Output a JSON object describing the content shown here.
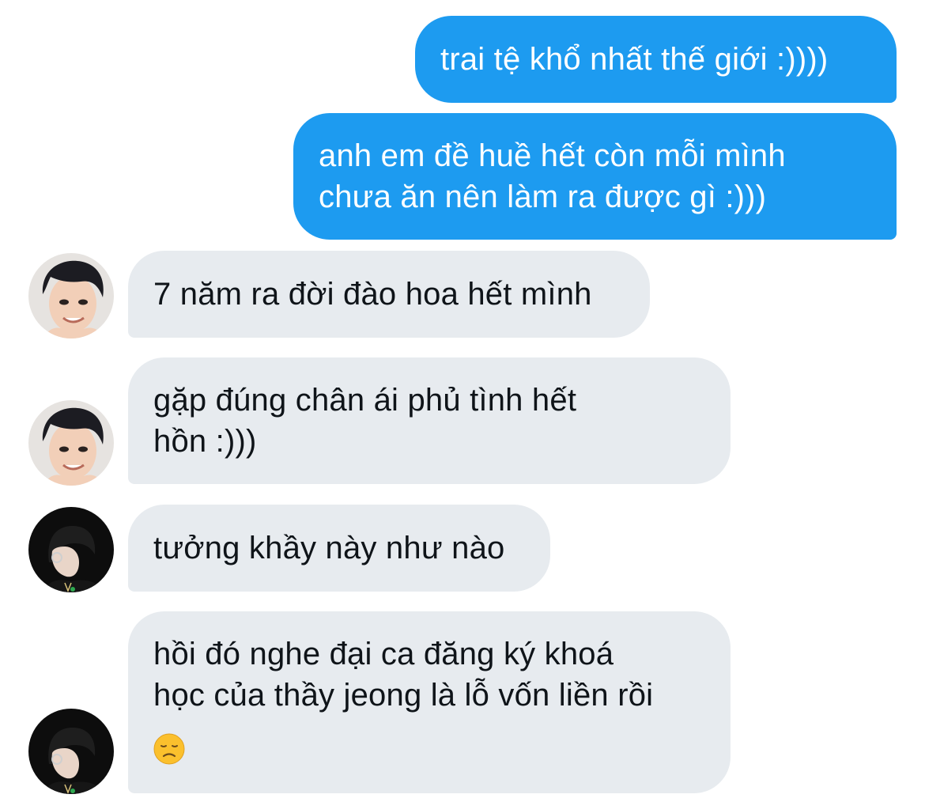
{
  "messages": [
    {
      "direction": "sent",
      "lines": [
        "trai tệ khổ nhất thế giới :))))"
      ]
    },
    {
      "direction": "sent",
      "lines": [
        "anh em đề huề hết còn mỗi mình",
        "chưa ăn nên làm ra được gì :)))"
      ]
    },
    {
      "direction": "received",
      "sender": "contact-1",
      "lines": [
        "7 năm ra đời đào hoa hết mình"
      ]
    },
    {
      "direction": "received",
      "sender": "contact-1",
      "lines": [
        "gặp đúng chân ái phủ tình hết",
        "hồn :)))"
      ]
    },
    {
      "direction": "received",
      "sender": "contact-2",
      "lines": [
        "tưởng khầy này như nào"
      ]
    },
    {
      "direction": "received",
      "sender": "contact-2",
      "lines": [
        "hồi đó nghe đại ca đăng ký khoá",
        "học của thầy jeong là lỗ vốn liền rồi"
      ],
      "emoji": "disappointed-face"
    }
  ],
  "colors": {
    "sent_bubble": "#1d9bf0",
    "received_bubble": "#e7ebef",
    "sent_text": "#ffffff",
    "received_text": "#0f1419"
  }
}
